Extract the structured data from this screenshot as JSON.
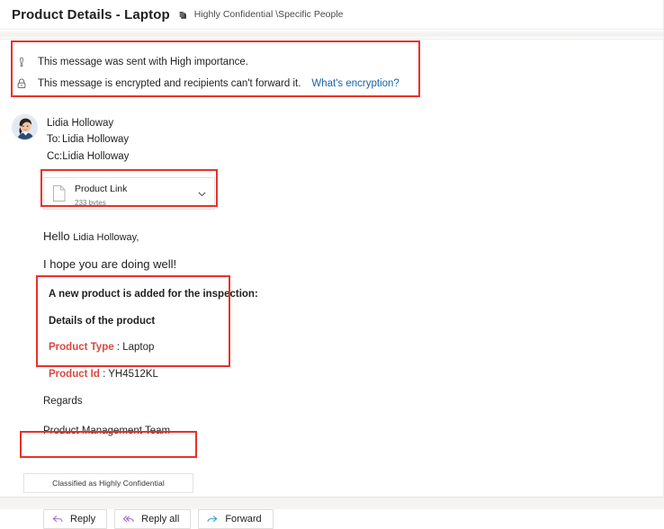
{
  "header": {
    "title": "Product Details - Laptop",
    "sensitivity_icon": "sensitivity-shield-icon",
    "sensitivity_label": "Highly Confidential \\Specific People"
  },
  "banner": {
    "importance": {
      "icon": "exclamation-icon",
      "text": "This message was sent with High importance."
    },
    "encryption": {
      "icon": "padlock-icon",
      "text": "This message is encrypted and recipients can't forward it.",
      "link_label": "What's encryption?",
      "link_color": "#1763ab"
    }
  },
  "message": {
    "avatar_icon": "sender-avatar-photo",
    "sender_name": "Lidia Holloway",
    "to_key": "To:",
    "to_value": "Lidia Holloway",
    "cc_key": "Cc:",
    "cc_value": "Lidia Holloway"
  },
  "attachment": {
    "file_icon": "file-document-icon",
    "name": "Product Link",
    "size": "233 bytes",
    "chevron_icon": "chevron-down-icon"
  },
  "body": {
    "greeting_prefix": "Hello ",
    "greeting_name": "Lidia Holloway,",
    "paragraph": "I hope you are doing well!",
    "details": {
      "heading": "A new product is added for the inspection:",
      "subheading": "Details of the product",
      "key_color": "#d9483f",
      "rows": [
        {
          "key": "Product Type",
          "separator": " : ",
          "value": "Laptop"
        },
        {
          "key": "Product Id",
          "separator": " : ",
          "value": "YH4512KL"
        }
      ]
    },
    "signoff": "Regards",
    "signature": "Product Management Team"
  },
  "classification": {
    "text": "Classified as Highly Confidential"
  },
  "actions": [
    {
      "label": "Reply",
      "icon": "reply-arrow-icon",
      "color": "#9b6fc4"
    },
    {
      "label": "Reply all",
      "icon": "reply-all-arrow-icon",
      "color": "#a05ec9"
    },
    {
      "label": "Forward",
      "icon": "forward-arrow-icon",
      "color": "#3a96d6"
    }
  ],
  "annotations": {
    "accent_color": "#e8312b"
  }
}
